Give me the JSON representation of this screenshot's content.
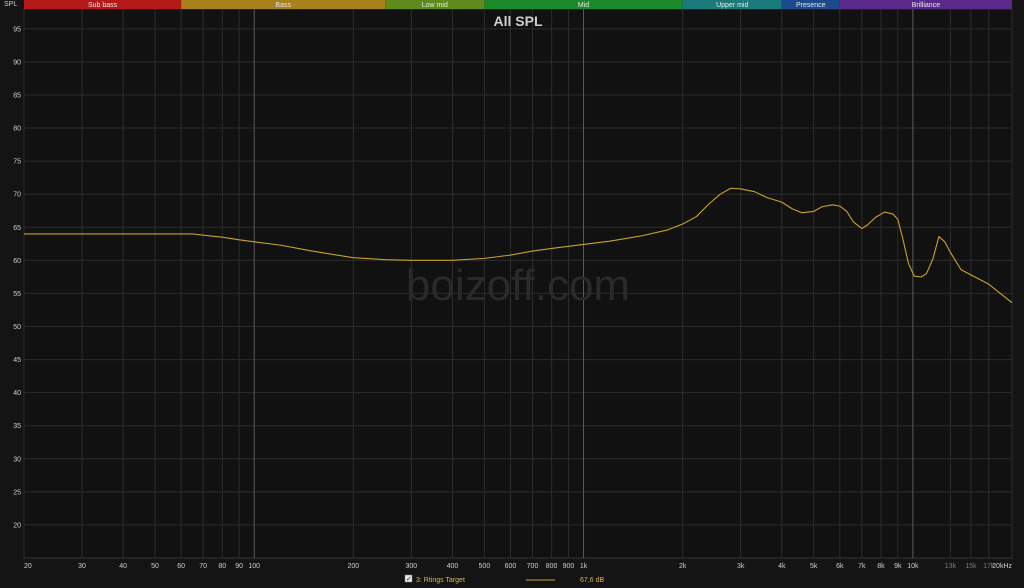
{
  "chart_data": {
    "type": "line",
    "title": "All SPL",
    "y_axis_name": "SPL",
    "watermark": "boizoff.com",
    "xlim": [
      20,
      20000
    ],
    "ylim": [
      15,
      98
    ],
    "x_scale": "log",
    "grid": true,
    "y_ticks": [
      20,
      25,
      30,
      35,
      40,
      45,
      50,
      55,
      60,
      65,
      70,
      75,
      80,
      85,
      90,
      95
    ],
    "x_ticks": [
      {
        "value": 20,
        "label": "20",
        "dim": false
      },
      {
        "value": 30,
        "label": "30",
        "dim": false
      },
      {
        "value": 40,
        "label": "40",
        "dim": false
      },
      {
        "value": 50,
        "label": "50",
        "dim": false
      },
      {
        "value": 60,
        "label": "60",
        "dim": false
      },
      {
        "value": 70,
        "label": "70",
        "dim": false
      },
      {
        "value": 80,
        "label": "80",
        "dim": false
      },
      {
        "value": 90,
        "label": "90",
        "dim": false
      },
      {
        "value": 100,
        "label": "100",
        "dim": false
      },
      {
        "value": 200,
        "label": "200",
        "dim": false
      },
      {
        "value": 300,
        "label": "300",
        "dim": false
      },
      {
        "value": 400,
        "label": "400",
        "dim": false
      },
      {
        "value": 500,
        "label": "500",
        "dim": false
      },
      {
        "value": 600,
        "label": "600",
        "dim": false
      },
      {
        "value": 700,
        "label": "700",
        "dim": false
      },
      {
        "value": 800,
        "label": "800",
        "dim": false
      },
      {
        "value": 900,
        "label": "900",
        "dim": false
      },
      {
        "value": 1000,
        "label": "1k",
        "dim": false
      },
      {
        "value": 2000,
        "label": "2k",
        "dim": false
      },
      {
        "value": 3000,
        "label": "3k",
        "dim": false
      },
      {
        "value": 4000,
        "label": "4k",
        "dim": false
      },
      {
        "value": 5000,
        "label": "5k",
        "dim": false
      },
      {
        "value": 6000,
        "label": "6k",
        "dim": false
      },
      {
        "value": 7000,
        "label": "7k",
        "dim": false
      },
      {
        "value": 8000,
        "label": "8k",
        "dim": false
      },
      {
        "value": 9000,
        "label": "9k",
        "dim": false
      },
      {
        "value": 10000,
        "label": "10k",
        "dim": false
      },
      {
        "value": 13000,
        "label": "13k",
        "dim": true
      },
      {
        "value": 15000,
        "label": "15k",
        "dim": true
      },
      {
        "value": 17000,
        "label": "17k",
        "dim": true
      },
      {
        "value": 20000,
        "label": "20kHz",
        "dim": false
      }
    ],
    "major_lines": [
      100,
      1000,
      10000
    ],
    "bands": [
      {
        "label": "Sub bass",
        "from": 20,
        "to": 60,
        "color": "#b41a1a"
      },
      {
        "label": "Bass",
        "from": 60,
        "to": 250,
        "color": "#a8801c"
      },
      {
        "label": "Low mid",
        "from": 250,
        "to": 500,
        "color": "#5f8a1c"
      },
      {
        "label": "Mid",
        "from": 500,
        "to": 2000,
        "color": "#1c8a2a"
      },
      {
        "label": "Upper mid",
        "from": 2000,
        "to": 4000,
        "color": "#1c7a7a"
      },
      {
        "label": "Presence",
        "from": 4000,
        "to": 6000,
        "color": "#1c4a8a"
      },
      {
        "label": "Brilliance",
        "from": 6000,
        "to": 20000,
        "color": "#5a2a8a"
      }
    ],
    "series": [
      {
        "name": "3: Rtings Target",
        "color": "#c9a227",
        "level": "67,6 dB",
        "checked": true,
        "points": [
          [
            20,
            64.0
          ],
          [
            40,
            64.0
          ],
          [
            60,
            64.0
          ],
          [
            65,
            64.0
          ],
          [
            70,
            63.8
          ],
          [
            80,
            63.5
          ],
          [
            90,
            63.1
          ],
          [
            100,
            62.8
          ],
          [
            120,
            62.3
          ],
          [
            150,
            61.4
          ],
          [
            200,
            60.4
          ],
          [
            250,
            60.1
          ],
          [
            300,
            60.0
          ],
          [
            400,
            60.0
          ],
          [
            500,
            60.3
          ],
          [
            600,
            60.8
          ],
          [
            700,
            61.4
          ],
          [
            800,
            61.8
          ],
          [
            1000,
            62.4
          ],
          [
            1200,
            62.9
          ],
          [
            1500,
            63.7
          ],
          [
            1800,
            64.6
          ],
          [
            2000,
            65.5
          ],
          [
            2200,
            66.6
          ],
          [
            2400,
            68.5
          ],
          [
            2600,
            70.0
          ],
          [
            2800,
            70.9
          ],
          [
            3000,
            70.8
          ],
          [
            3300,
            70.4
          ],
          [
            3600,
            69.5
          ],
          [
            4000,
            68.8
          ],
          [
            4300,
            67.8
          ],
          [
            4600,
            67.2
          ],
          [
            5000,
            67.4
          ],
          [
            5300,
            68.1
          ],
          [
            5700,
            68.4
          ],
          [
            6000,
            68.2
          ],
          [
            6300,
            67.4
          ],
          [
            6600,
            65.8
          ],
          [
            7000,
            64.8
          ],
          [
            7300,
            65.4
          ],
          [
            7700,
            66.5
          ],
          [
            8200,
            67.3
          ],
          [
            8700,
            67.0
          ],
          [
            9000,
            66.2
          ],
          [
            9300,
            63.5
          ],
          [
            9700,
            59.5
          ],
          [
            10100,
            57.6
          ],
          [
            10600,
            57.5
          ],
          [
            11000,
            58.0
          ],
          [
            11500,
            60.2
          ],
          [
            12000,
            63.6
          ],
          [
            12500,
            62.8
          ],
          [
            13000,
            61.2
          ],
          [
            14000,
            58.6
          ],
          [
            15000,
            57.8
          ],
          [
            17000,
            56.4
          ],
          [
            20000,
            53.6
          ]
        ]
      }
    ]
  }
}
